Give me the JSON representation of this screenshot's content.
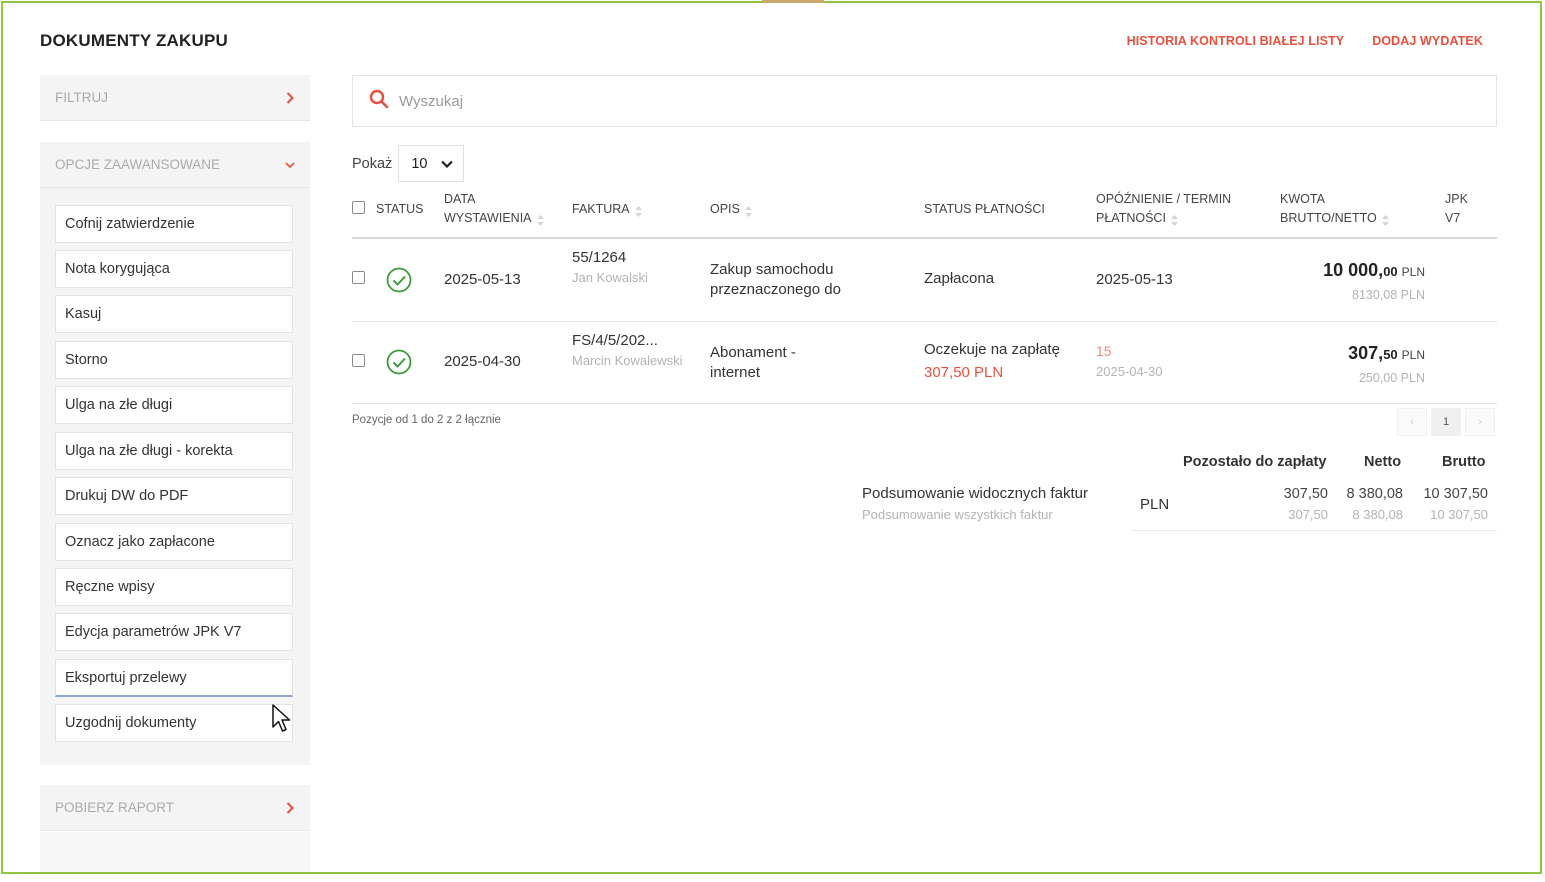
{
  "header": {
    "title": "DOKUMENTY ZAKUPU",
    "link_history": "HISTORIA KONTROLI BIAŁEJ LISTY",
    "link_add": "DODAJ WYDATEK"
  },
  "sidebar": {
    "filter_label": "FILTRUJ",
    "advanced_label": "OPCJE ZAAWANSOWANE",
    "report_label": "POBIERZ RAPORT",
    "advanced_items": [
      {
        "label": "Cofnij zatwierdzenie"
      },
      {
        "label": "Nota korygująca"
      },
      {
        "label": "Kasuj"
      },
      {
        "label": "Storno"
      },
      {
        "label": "Ulga na złe długi"
      },
      {
        "label": "Ulga na złe długi - korekta"
      },
      {
        "label": "Drukuj DW do PDF"
      },
      {
        "label": "Oznacz jako zapłacone"
      },
      {
        "label": "Ręczne wpisy"
      },
      {
        "label": "Edycja parametrów JPK V7"
      },
      {
        "label": "Eksportuj przelewy"
      },
      {
        "label": "Uzgodnij dokumenty"
      }
    ]
  },
  "search": {
    "placeholder": "Wyszukaj"
  },
  "show": {
    "label": "Pokaż",
    "value": "10"
  },
  "table": {
    "headers": {
      "status": "STATUS",
      "date_1": "DATA",
      "date_2": "WYSTAWIENIA",
      "invoice": "FAKTURA",
      "desc": "OPIS",
      "payment_status": "STATUS PŁATNOŚCI",
      "delay_1": "OPÓŹNIENIE / TERMIN",
      "delay_2": "PŁATNOŚCI",
      "amount_1": "KWOTA",
      "amount_2": "BRUTTO/NETTO",
      "jpk_1": "JPK",
      "jpk_2": "V7"
    },
    "rows": [
      {
        "date": "2025-05-13",
        "invoice_no": "55/1264",
        "contractor": "Jan Kowalski",
        "desc_1": "Zakup samochodu",
        "desc_2": "przeznaczonego do",
        "payment_status": "Zapłacona",
        "payment_amount": "",
        "delay": "",
        "due_date": "2025-05-13",
        "gross_int": "10 000,",
        "gross_dec": "00",
        "currency": "PLN",
        "net": "8130,08 PLN"
      },
      {
        "date": "2025-04-30",
        "invoice_no": "FS/4/5/202...",
        "contractor": "Marcin Kowalewski",
        "desc_1": "Abonament -",
        "desc_2": "internet",
        "payment_status": "Oczekuje na zapłatę",
        "payment_amount": "307,50 PLN",
        "delay": "15",
        "due_date": "2025-04-30",
        "gross_int": "307,",
        "gross_dec": "50",
        "currency": "PLN",
        "net": "250,00 PLN"
      }
    ]
  },
  "pagination": {
    "info": "Pozycje od 1 do 2 z 2 łącznie",
    "prev": "‹",
    "page": "1",
    "next": "›"
  },
  "summary": {
    "col_remaining": "Pozostało do zapłaty",
    "col_net": "Netto",
    "col_gross": "Brutto",
    "label_visible": "Podsumowanie widocznych faktur",
    "label_all": "Podsumowanie wszystkich faktur",
    "currency": "PLN",
    "visible": {
      "remaining": "307,50",
      "net": "8 380,08",
      "gross": "10 307,50"
    },
    "all": {
      "remaining": "307,50",
      "net": "8 380,08",
      "gross": "10 307,50"
    }
  },
  "colors": {
    "accent": "#e9503c",
    "frame": "#8dc63f",
    "ok": "#3a9d3a"
  }
}
